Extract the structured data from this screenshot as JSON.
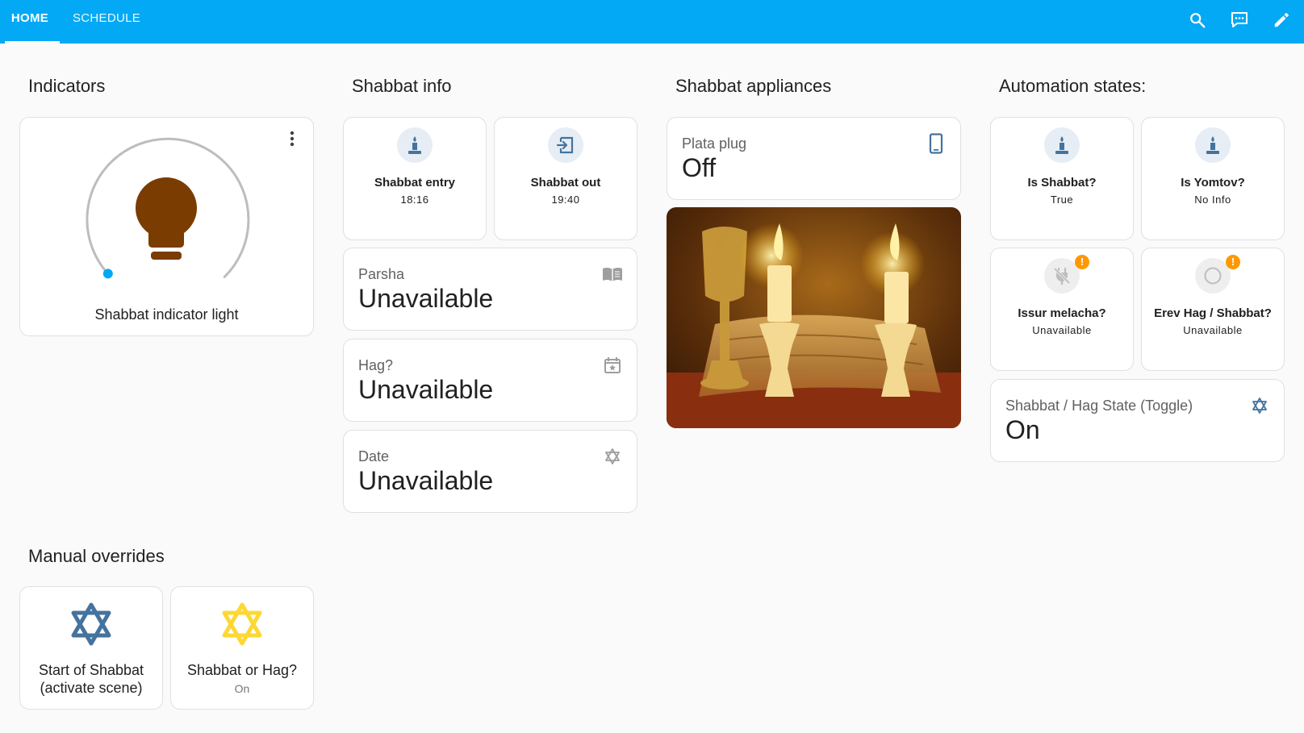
{
  "header": {
    "tabs": [
      {
        "label": "HOME",
        "active": true
      },
      {
        "label": "SCHEDULE",
        "active": false
      }
    ],
    "icons": [
      "search-icon",
      "assist-icon",
      "edit-icon"
    ]
  },
  "colors": {
    "header": "#03a9f4",
    "icon_blue": "#44739e",
    "light_brown": "#7a3c00",
    "star_yellow": "#fdd835",
    "badge_orange": "#ff9800"
  },
  "indicators": {
    "title": "Indicators",
    "light": {
      "name": "Shabbat indicator light",
      "icon": "lightbulb-icon",
      "brightness_percent": 0
    }
  },
  "shabbat_info": {
    "title": "Shabbat info",
    "entry": {
      "name": "Shabbat entry",
      "state": "18:16",
      "icon": "candle-icon"
    },
    "out": {
      "name": "Shabbat out",
      "state": "19:40",
      "icon": "exit-icon"
    },
    "parsha": {
      "name": "Parsha",
      "value": "Unavailable",
      "icon": "book-icon"
    },
    "hag": {
      "name": "Hag?",
      "value": "Unavailable",
      "icon": "calendar-star-icon"
    },
    "date": {
      "name": "Date",
      "value": "Unavailable",
      "icon": "star-of-david-icon"
    }
  },
  "appliances": {
    "title": "Shabbat appliances",
    "plug": {
      "name": "Plata plug",
      "value": "Off",
      "icon": "phone-icon"
    }
  },
  "automation": {
    "title": "Automation states:",
    "is_shabbat": {
      "name": "Is Shabbat?",
      "state": "True"
    },
    "is_yomtov": {
      "name": "Is Yomtov?",
      "state": "No Info"
    },
    "issur": {
      "name": "Issur melacha?",
      "state": "Unavailable",
      "badge": "!"
    },
    "erev": {
      "name": "Erev Hag / Shabbat?",
      "state": "Unavailable",
      "badge": "!"
    },
    "toggle": {
      "name": "Shabbat / Hag State (Toggle)",
      "value": "On"
    }
  },
  "overrides": {
    "title": "Manual overrides",
    "start": {
      "name_line1": "Start of Shabbat",
      "name_line2": "(activate scene)"
    },
    "shabbat_or_hag": {
      "name": "Shabbat or Hag?",
      "state": "On"
    }
  }
}
